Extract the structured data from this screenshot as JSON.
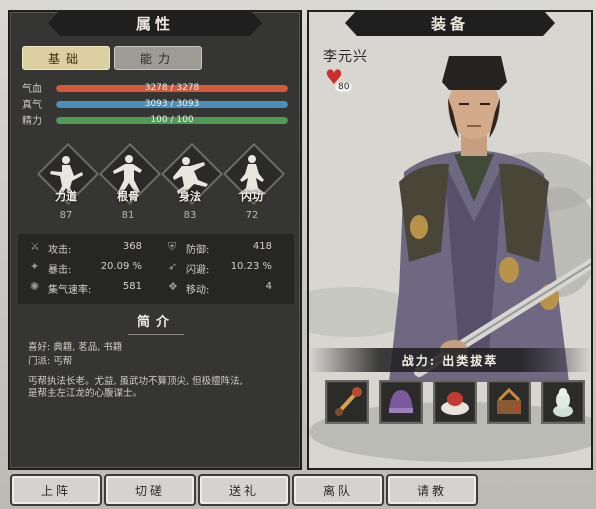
{
  "left_panel": {
    "title": "属性",
    "tabs": [
      {
        "label": "基础"
      },
      {
        "label": "能力"
      }
    ],
    "bars": [
      {
        "label": "气血",
        "text": "3278 / 3278",
        "fraction": 1.0,
        "color": "#d25a3a"
      },
      {
        "label": "真气",
        "text": "3093 / 3093",
        "fraction": 1.0,
        "color": "#4c8fb8"
      },
      {
        "label": "精力",
        "text": "100 / 100",
        "fraction": 1.0,
        "color": "#4f9a55"
      }
    ],
    "skills": [
      {
        "name": "力道",
        "value": "87"
      },
      {
        "name": "根骨",
        "value": "81"
      },
      {
        "name": "身法",
        "value": "83"
      },
      {
        "name": "内功",
        "value": "72"
      }
    ],
    "stats": [
      {
        "label": "攻击:",
        "value": "368"
      },
      {
        "label": "防御:",
        "value": "418"
      },
      {
        "label": "暴击:",
        "value": "20.09 %"
      },
      {
        "label": "闪避:",
        "value": "10.23 %"
      },
      {
        "label": "集气速率:",
        "value": "581"
      },
      {
        "label": "移动:",
        "value": "4"
      }
    ],
    "intro_title": "简介",
    "intro": {
      "hobby": "喜好: 典籍, 茗品, 书籍",
      "sect": "门派: 丐帮",
      "bio_1": "丐帮执法长老。尤益, 虽武功不算顶尖, 但极擅阵法,",
      "bio_2": "是帮主左江龙的心腹谋士。"
    }
  },
  "right_panel": {
    "title": "装备",
    "char_name": "李元兴",
    "favor": "80",
    "power_text": "战力: 出类拔萃",
    "equipment": [
      {
        "icon": "weapon-icon"
      },
      {
        "icon": "helmet-icon"
      },
      {
        "icon": "hat-icon"
      },
      {
        "icon": "manual-icon"
      },
      {
        "icon": "statue-icon"
      }
    ]
  },
  "buttons": [
    {
      "label": "上阵"
    },
    {
      "label": "切磋"
    },
    {
      "label": "送礼"
    },
    {
      "label": "离队"
    },
    {
      "label": "请教"
    }
  ],
  "colors": {
    "hp": "#d25a3a",
    "mp": "#4c8fb8",
    "stamina": "#4f9a55",
    "heart": "#c9302c"
  }
}
